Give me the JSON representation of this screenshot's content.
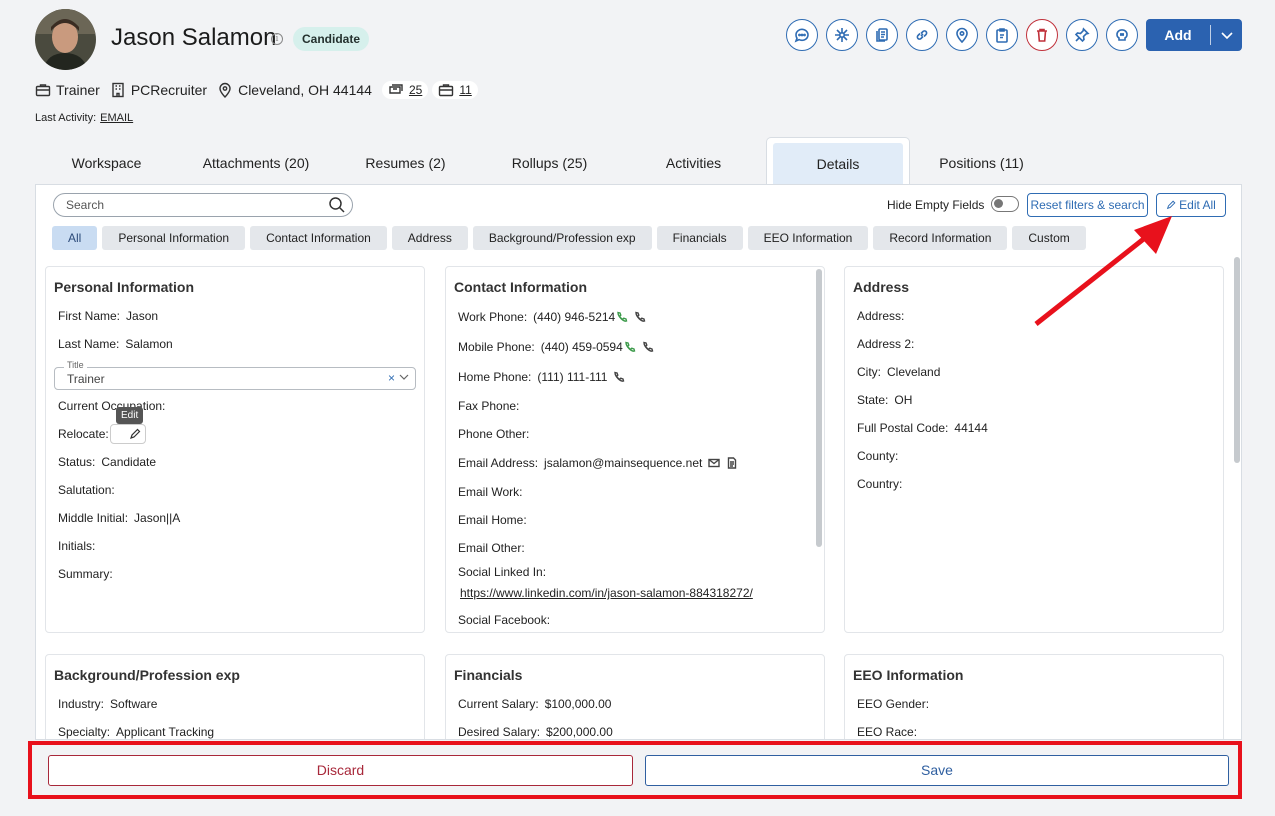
{
  "header": {
    "name": "Jason Salamon",
    "info_symbol": "i",
    "badge": "Candidate",
    "add_label": "Add"
  },
  "meta": {
    "title": "Trainer",
    "company": "PCRecruiter",
    "location": "Cleveland, OH 44144",
    "rollups_count": "25",
    "positions_count": "11",
    "last_activity_label": "Last Activity:",
    "last_activity_value": "EMAIL"
  },
  "tabs": [
    {
      "label": "Workspace"
    },
    {
      "label": "Attachments (20)"
    },
    {
      "label": "Resumes (2)"
    },
    {
      "label": "Rollups (25)"
    },
    {
      "label": "Activities"
    },
    {
      "label": "Details"
    },
    {
      "label": "Positions (11)"
    }
  ],
  "toolbar": {
    "search_placeholder": "Search",
    "hide_empty": "Hide Empty Fields",
    "reset": "Reset filters & search",
    "edit_all": "Edit All"
  },
  "filters": [
    "All",
    "Personal Information",
    "Contact Information",
    "Address",
    "Background/Profession exp",
    "Financials",
    "EEO Information",
    "Record Information",
    "Custom"
  ],
  "personal": {
    "heading": "Personal Information",
    "first_name_label": "First Name:",
    "first_name": "Jason",
    "last_name_label": "Last Name:",
    "last_name": "Salamon",
    "title_legend": "Title",
    "title_value": "Trainer",
    "title_clear": "×",
    "current_occupation_label": "Current Occupation:",
    "tooltip": "Edit",
    "relocate_label": "Relocate:",
    "status_label": "Status:",
    "status": "Candidate",
    "salutation_label": "Salutation:",
    "middle_initial_label": "Middle Initial:",
    "middle_initial": "Jason||A",
    "initials_label": "Initials:",
    "summary_label": "Summary:"
  },
  "contact": {
    "heading": "Contact Information",
    "work_phone_label": "Work Phone:",
    "work_phone": "(440) 946-5214",
    "mobile_phone_label": "Mobile Phone:",
    "mobile_phone": "(440) 459-0594",
    "home_phone_label": "Home Phone:",
    "home_phone": "(111) 111-111",
    "fax_label": "Fax Phone:",
    "phone_other_label": "Phone Other:",
    "email_label": "Email Address:",
    "email": "jsalamon@mainsequence.net",
    "email_work_label": "Email Work:",
    "email_home_label": "Email Home:",
    "email_other_label": "Email Other:",
    "linkedin_label": "Social Linked In:",
    "linkedin": "https://www.linkedin.com/in/jason-salamon-884318272/",
    "facebook_label": "Social Facebook:"
  },
  "address": {
    "heading": "Address",
    "address_label": "Address:",
    "address2_label": "Address 2:",
    "city_label": "City:",
    "city": "Cleveland",
    "state_label": "State:",
    "state": "OH",
    "postal_label": "Full Postal Code:",
    "postal": "44144",
    "county_label": "County:",
    "country_label": "Country:"
  },
  "background": {
    "heading": "Background/Profession exp",
    "industry_label": "Industry:",
    "industry": "Software",
    "specialty_label": "Specialty:",
    "specialty": "Applicant Tracking"
  },
  "financials": {
    "heading": "Financials",
    "current_label": "Current Salary:",
    "current": "$100,000.00",
    "desired_label": "Desired Salary:",
    "desired": "$200,000.00"
  },
  "eeo": {
    "heading": "EEO Information",
    "gender_label": "EEO Gender:",
    "race_label": "EEO Race:"
  },
  "footer": {
    "discard": "Discard",
    "save": "Save"
  },
  "colors": {
    "accent": "#2f6cb3",
    "annotation": "#e8111c",
    "badge_bg": "#d6f0ec"
  }
}
